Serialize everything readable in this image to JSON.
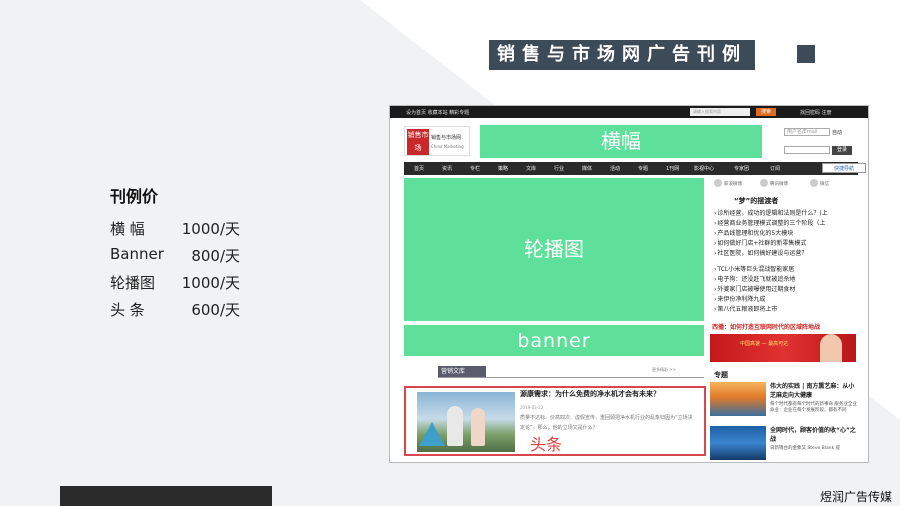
{
  "slide": {
    "title": "销售与市场网广告刊例",
    "price_title": "刊例价",
    "prices": [
      {
        "name": "横 幅",
        "value": "1000/天"
      },
      {
        "name": "Banner",
        "value": "800/天"
      },
      {
        "name": "轮播图",
        "value": "1000/天"
      },
      {
        "name": "头 条",
        "value": "600/天"
      }
    ],
    "brand": "煜润广告传媒",
    "colors": {
      "title_bg": "#3d4a57",
      "ad_green": "#5ee09a",
      "headline_red": "#d8474b"
    }
  },
  "site": {
    "topbar": {
      "left": "设为首页   收藏本站   精彩专题",
      "search_placeholder": "请输入搜索内容",
      "search_button": "搜索",
      "right": "找回密码   注册"
    },
    "logo": {
      "mark": "销售市场",
      "name": "销售与市场网",
      "sub": "China Marketing"
    },
    "banner_label": "横幅",
    "login": {
      "user_placeholder": "用户名/Email",
      "auto": "自动",
      "button": "登录"
    },
    "nav": [
      "首页",
      "资讯",
      "专栏",
      "策略",
      "文库",
      "行业",
      "媒体",
      "活动",
      "专题",
      "1刊网",
      "影视中心",
      "专家团",
      "订阅"
    ],
    "quick_nav": "快捷导航",
    "carousel_label": "轮播图",
    "mid_banner_label": "banner",
    "section_tab": "营销文库",
    "section_more": "更多精彩 >>",
    "headline": {
      "title": "源康需求：为什么免费的净水机才会有未来？",
      "date": "2019-03-22",
      "body": "质量不达标、价高四次、虚假宣传，重回顾把净水机行业的乱象归因为“立场决定论”。那么，他的立场又是什么？",
      "label": "头条"
    },
    "share": [
      "新浪微博",
      "腾讯微博",
      "微信"
    ],
    "dream_title": "“梦”的摆渡者",
    "news": [
      "诊所经营，成功的逻辑和法则是什么？(上",
      "经营商业务管理模式调整的三个阶段（上",
      "产品线管理和优化的5大模块",
      "如何做好门店+社群的新零售模式",
      "社区医院，如何搞好建设与运营？",
      "TCL小米等巨头混战智能家居",
      "电子狗：还没赶飞就被追杀地",
      "外婆家门店被曝使用过期食材",
      "来伊份净利降九成",
      "第八代五粮液即将上市"
    ],
    "ad_title": "西播：如何打造互联网时代的区域阵地战",
    "ad_text": "中国高速 — 最高可达",
    "topics_label": "专题",
    "topics": [
      {
        "title": "伟大的实践 | 南方熏艺麻：从小芝麻走向大健康",
        "body": "每个时代都有每个时代的新事命 服务业全业命业：企业在每个发展阶段，都有不同"
      },
      {
        "title": "全网时代，顾客价值的收“心”之战",
        "body": "日新锦台的金象又 Steve Blank 提"
      }
    ]
  }
}
